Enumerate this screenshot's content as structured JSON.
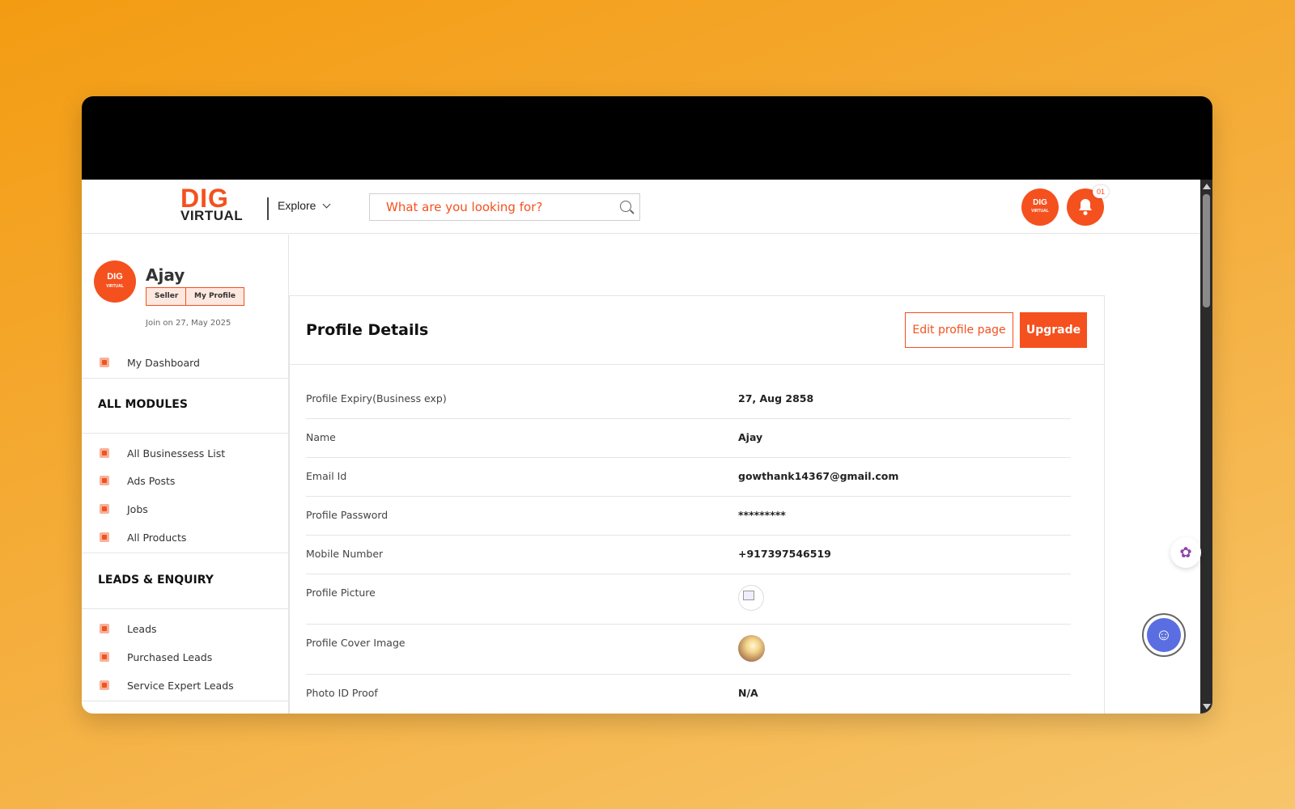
{
  "header": {
    "logo_top": "DIG",
    "logo_bottom": "VIRTUAL",
    "explore_label": "Explore",
    "search_placeholder": "What are you looking for?",
    "avatar_top": "DIG",
    "avatar_bottom": "VIRTUAL",
    "notification_count": "01"
  },
  "sidebar": {
    "avatar_top": "DIG",
    "avatar_bottom": "VIRTUAL",
    "user_name": "Ajay",
    "tag_seller": "Seller",
    "tag_profile": "My Profile",
    "join_text": "Join on 27, May 2025",
    "dashboard_label": "My Dashboard",
    "section_modules": "ALL MODULES",
    "modules": [
      {
        "label": "All Businessess List"
      },
      {
        "label": "Ads Posts"
      },
      {
        "label": "Jobs"
      },
      {
        "label": "All Products"
      }
    ],
    "section_leads": "LEADS & ENQUIRY",
    "leads": [
      {
        "label": "Leads"
      },
      {
        "label": "Purchased Leads"
      },
      {
        "label": "Service Expert Leads"
      }
    ]
  },
  "main": {
    "title": "Profile Details",
    "edit_label": "Edit profile page",
    "upgrade_label": "Upgrade",
    "rows": [
      {
        "label": "Profile Expiry(Business exp)",
        "value": "27, Aug 2858"
      },
      {
        "label": "Name",
        "value": "Ajay"
      },
      {
        "label": "Email Id",
        "value": "gowthank14367@gmail.com"
      },
      {
        "label": "Profile Password",
        "value": "*********"
      },
      {
        "label": "Mobile Number",
        "value": "+917397546519"
      },
      {
        "label": "Profile Picture",
        "value": ""
      },
      {
        "label": "Profile Cover Image",
        "value": ""
      },
      {
        "label": "Photo ID Proof",
        "value": "N/A"
      }
    ]
  },
  "colors": {
    "accent": "#f4511e",
    "background_gradient_start": "#f39c12",
    "background_gradient_end": "#f7c56a"
  },
  "icons": {
    "search": "search-icon",
    "bell": "bell-icon",
    "brain": "brain-icon",
    "agent": "support-agent-icon"
  }
}
